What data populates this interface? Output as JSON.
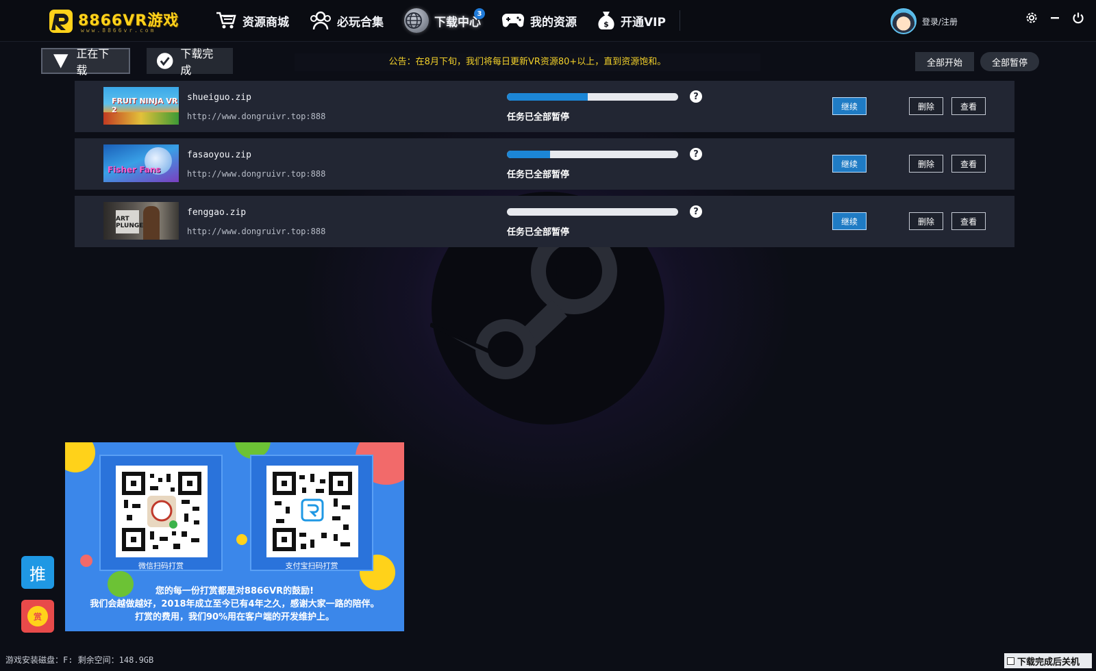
{
  "app": {
    "brand": "8866VR游戏",
    "brand_sub": "www.8866vr.com"
  },
  "nav": {
    "items": [
      {
        "label": "资源商城",
        "icon": "cart-icon"
      },
      {
        "label": "必玩合集",
        "icon": "group-icon"
      },
      {
        "label": "下载中心",
        "icon": "globe-icon",
        "badge": "3",
        "active": true
      },
      {
        "label": "我的资源",
        "icon": "gamepad-icon"
      },
      {
        "label": "开通VIP",
        "icon": "money-bag-icon"
      }
    ]
  },
  "user": {
    "login_label": "登录/注册"
  },
  "window_controls": {
    "settings_icon": "gear-icon",
    "minimize": "−",
    "power_icon": "power-icon"
  },
  "tabs": {
    "downloading": "正在下载",
    "completed": "下载完成"
  },
  "notice": "公告：在8月下旬，我们将每日更新VR资源80+以上，直到资源饱和。",
  "actions": {
    "start_all": "全部开始",
    "pause_all": "全部暂停"
  },
  "downloads": [
    {
      "file": "shueiguo.zip",
      "url": "http://www.dongruivr.top:888",
      "progress": 0.47,
      "status": "任务已全部暂停",
      "thumb_text": "FRUIT NINJA VR 2",
      "continue": "继续",
      "delete": "删除",
      "view": "查看",
      "help": "?"
    },
    {
      "file": "fasaoyou.zip",
      "url": "http://www.dongruivr.top:888",
      "progress": 0.25,
      "status": "任务已全部暂停",
      "thumb_text": "Fisher Fans",
      "continue": "继续",
      "delete": "删除",
      "view": "查看",
      "help": "?"
    },
    {
      "file": "fenggao.zip",
      "url": "http://www.dongruivr.top:888",
      "progress": 0.0,
      "status": "任务已全部暂停",
      "thumb_text": "ART PLUNGE",
      "continue": "继续",
      "delete": "删除",
      "view": "查看",
      "help": "?"
    }
  ],
  "donate": {
    "wechat_caption": "微信扫码打赏",
    "alipay_caption": "支付宝扫码打赏",
    "line1": "您的每一份打赏都是对8866VR的鼓励!",
    "line2": "我们会越做越好，2018年成立至今已有4年之久，感谢大家一路的陪伴。",
    "line3": "打赏的费用，我们90%用在客户端的开发维护上。"
  },
  "side": {
    "push": "推",
    "reward": "赏"
  },
  "footer": {
    "disk": "游戏安装磁盘：F:  剩余空间：148.9GB",
    "shutdown_label": "下载完成后关机"
  },
  "colors": {
    "accent": "#1f7bc4",
    "notice": "#f3d12a",
    "brand": "#ffd21a",
    "donate_bg": "#3b87ea"
  }
}
